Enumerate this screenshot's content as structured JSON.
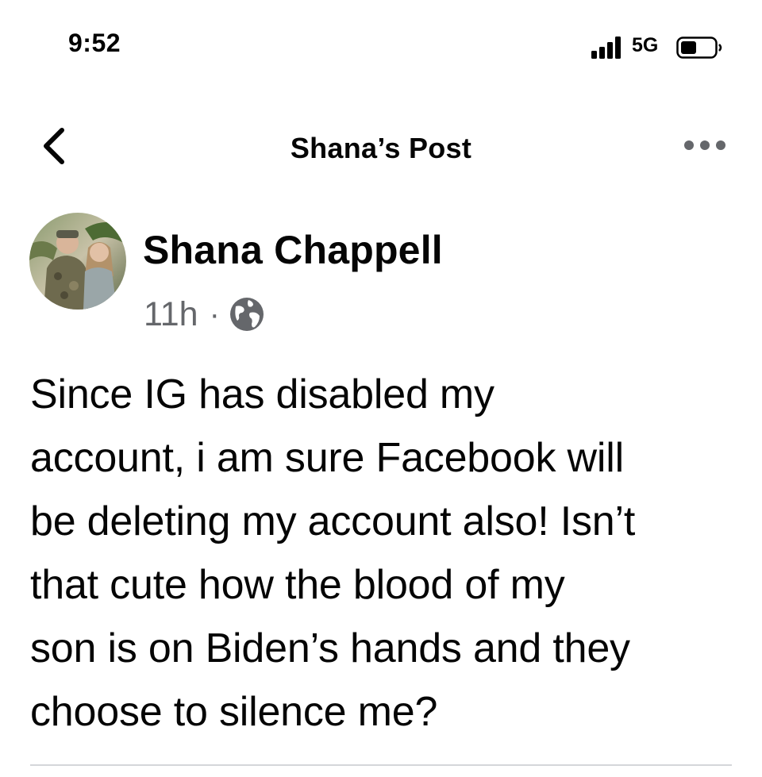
{
  "status_bar": {
    "time": "9:52",
    "network": "5G",
    "icons": [
      "signal-bars-icon",
      "battery-icon"
    ]
  },
  "header": {
    "title": "Shana’s Post",
    "back_icon": "chevron-left-icon",
    "more_icon": "more-dots-icon"
  },
  "post": {
    "author": "Shana Chappell",
    "time_ago": "11h",
    "separator": "·",
    "audience_icon": "globe-icon",
    "text_lines": [
      "Since IG has disabled my",
      "account, i am sure Facebook will",
      "be deleting my account also! Isn’t",
      "that cute how the blood of my",
      "son is on Biden’s hands and they",
      "choose to silence me?"
    ]
  },
  "colors": {
    "text_primary": "#050505",
    "text_secondary": "#65676b",
    "divider": "#d4d6da"
  }
}
